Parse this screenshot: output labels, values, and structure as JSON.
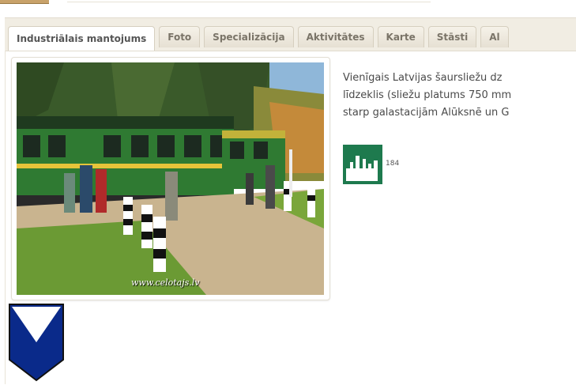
{
  "tabs": [
    {
      "label": "Industriālais mantojums",
      "active": true
    },
    {
      "label": "Foto",
      "active": false
    },
    {
      "label": "Specializācija",
      "active": false
    },
    {
      "label": "Aktivitātes",
      "active": false
    },
    {
      "label": "Karte",
      "active": false
    },
    {
      "label": "Stāsti",
      "active": false
    },
    {
      "label": "Al",
      "active": false
    }
  ],
  "photo": {
    "watermark": "www.celotajs.lv"
  },
  "description": {
    "line1": "Vienīgais Latvijas šaursliežu dz",
    "line2": "līdzeklis (sliežu platums 750 mm",
    "line3": "starp galastacijām Alūksnē un G"
  },
  "rating": {
    "icon": "city-skyline-icon",
    "count": "184",
    "color": "#1e7a4e"
  },
  "coat_of_arms": {
    "icon": "coat-of-arms-icon",
    "color": "#0a2a8a"
  }
}
